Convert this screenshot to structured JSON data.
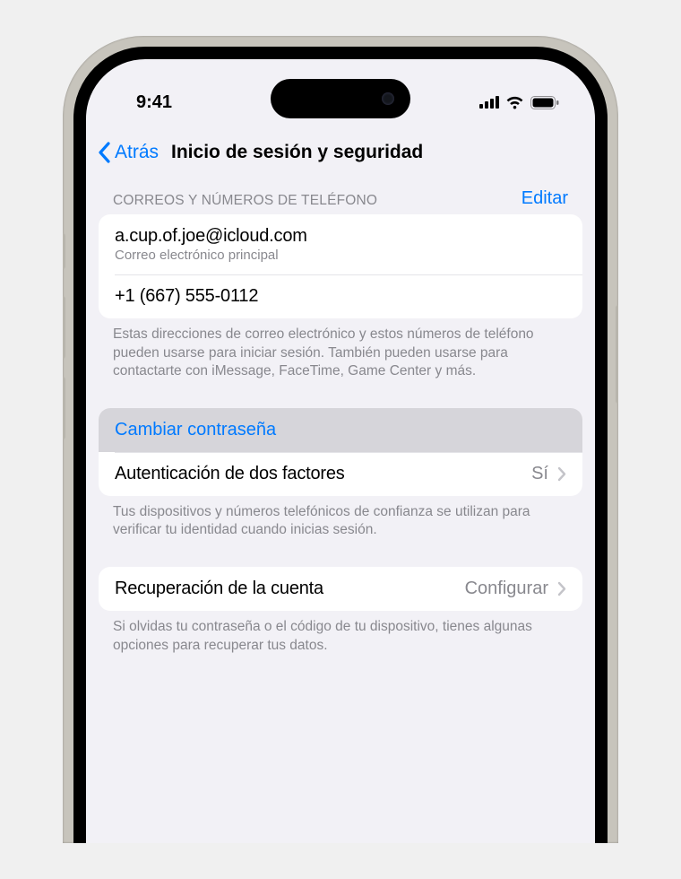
{
  "status": {
    "time": "9:41"
  },
  "nav": {
    "back_label": "Atrás",
    "title": "Inicio de sesión y seguridad"
  },
  "contacts": {
    "section_label": "CORREOS Y NÚMEROS DE TELÉFONO",
    "edit_label": "Editar",
    "email": "a.cup.of.joe@icloud.com",
    "email_sub": "Correo electrónico principal",
    "phone": "+1 (667) 555-0112",
    "footer": "Estas direcciones de correo electrónico y estos números de teléfono pueden usarse para iniciar sesión. También pueden usarse para contactarte con iMessage, FaceTime, Game Center y más."
  },
  "security": {
    "change_password": "Cambiar contraseña",
    "two_factor_label": "Autenticación de dos factores",
    "two_factor_value": "Sí",
    "two_factor_footer": "Tus dispositivos y números telefónicos de confianza se utilizan para verificar tu identidad cuando inicias sesión."
  },
  "recovery": {
    "label": "Recuperación de la cuenta",
    "value": "Configurar",
    "footer": "Si olvidas tu contraseña o el código de tu dispositivo, tienes algunas opciones para recuperar tus datos."
  }
}
